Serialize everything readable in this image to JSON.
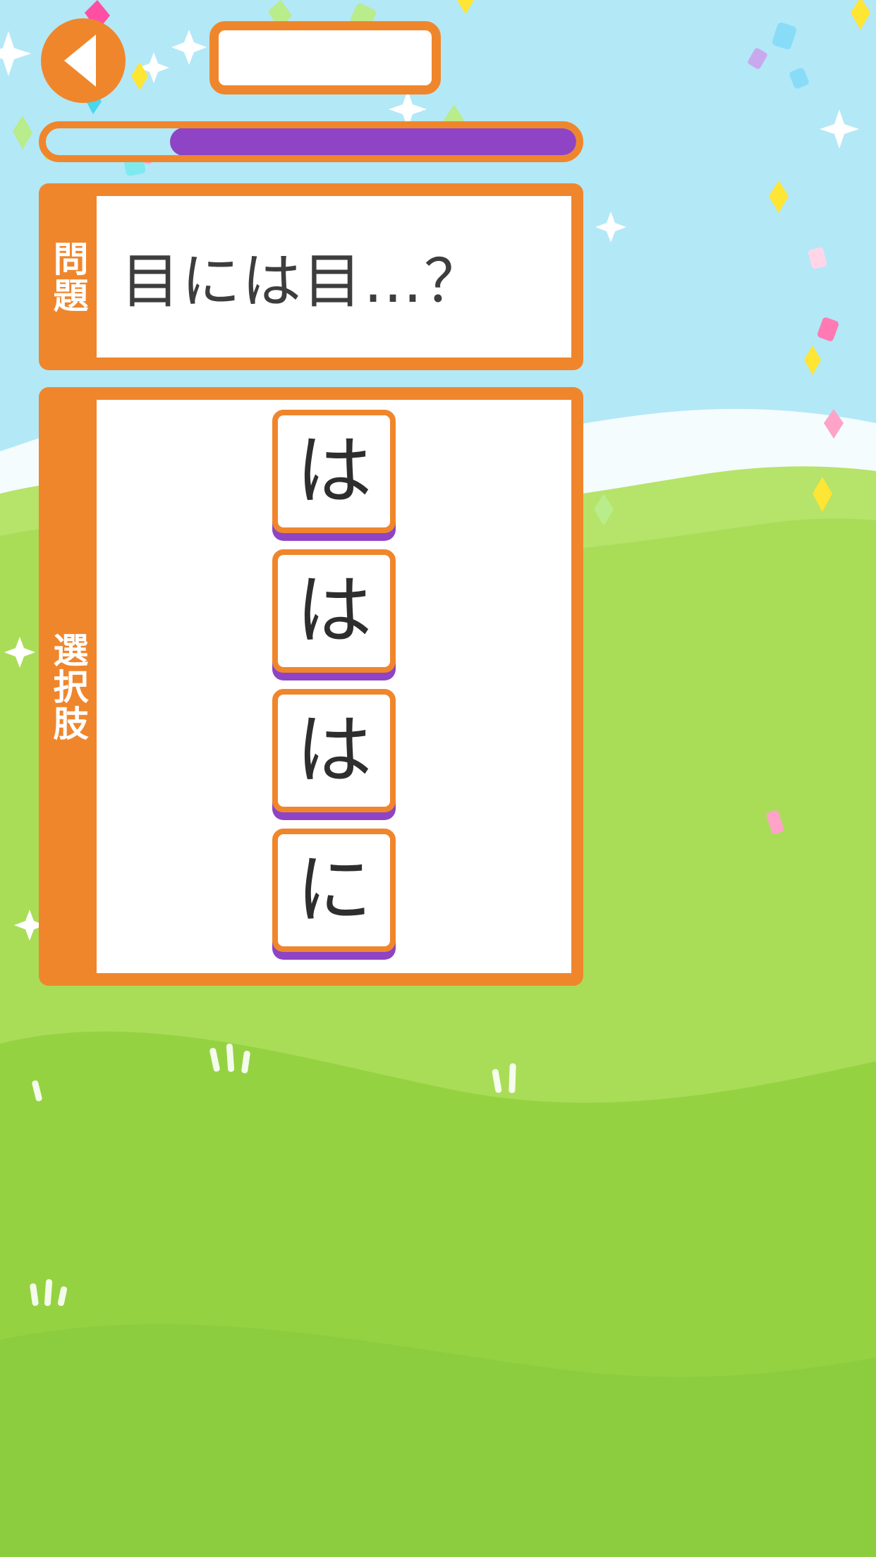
{
  "theme": {
    "sky_color": "#b3e8f7",
    "orange": "#f0862c",
    "purple": "#8e44c4",
    "grass_light": "#a8dd5a",
    "grass_dark": "#8ccc3f",
    "white": "#ffffff",
    "text_dark": "#3d3d3d"
  },
  "top_bar": {
    "back_button_icon": "triangle-left-icon",
    "title_text": ""
  },
  "progress": {
    "percent": 77,
    "fill_color": "#8e44c4",
    "track_color": "#b3e8f7",
    "border_color": "#f0862c"
  },
  "question_section": {
    "label": "問題",
    "text": "目には目…？"
  },
  "choices_section": {
    "label": "選択肢",
    "items": [
      {
        "text": "は"
      },
      {
        "text": "は"
      },
      {
        "text": "は"
      },
      {
        "text": "に"
      }
    ]
  }
}
